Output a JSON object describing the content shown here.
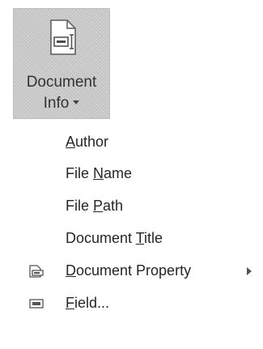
{
  "ribbon": {
    "button_line1": "Document",
    "button_line2": "Info",
    "icon": "document-info-icon"
  },
  "menu": {
    "items": [
      {
        "label_pre": "",
        "label_key": "A",
        "label_post": "uthor"
      },
      {
        "label_pre": "File ",
        "label_key": "N",
        "label_post": "ame"
      },
      {
        "label_pre": "File ",
        "label_key": "P",
        "label_post": "ath"
      },
      {
        "label_pre": "Document ",
        "label_key": "T",
        "label_post": "itle"
      },
      {
        "label_pre": "",
        "label_key": "D",
        "label_post": "ocument Property",
        "icon": "document-property-icon",
        "has_submenu": true
      },
      {
        "label_pre": "",
        "label_key": "F",
        "label_post": "ield...",
        "icon": "field-icon"
      }
    ]
  }
}
